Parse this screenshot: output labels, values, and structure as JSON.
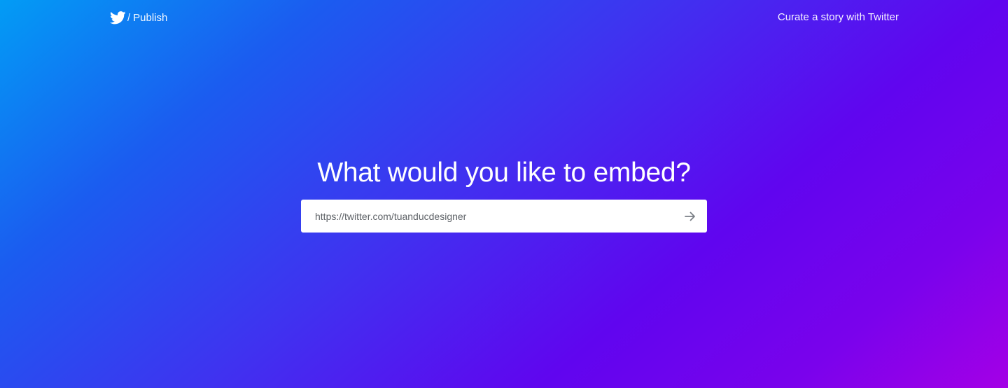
{
  "header": {
    "brand_icon": "twitter-bird-icon",
    "separator": "/",
    "brand_label": "Publish",
    "curate_link": "Curate a story with Twitter"
  },
  "main": {
    "headline": "What would you like to embed?",
    "embed_input": {
      "value": "https://twitter.com/tuanducdesigner",
      "placeholder": ""
    },
    "submit_icon": "arrow-right-icon"
  },
  "colors": {
    "gradient_start": "#029cf5",
    "gradient_mid": "#6005ef",
    "gradient_end": "#a400e6",
    "text": "#ffffff",
    "input_background": "#ffffff",
    "input_text": "#5f6368",
    "arrow": "#7a7f86"
  }
}
